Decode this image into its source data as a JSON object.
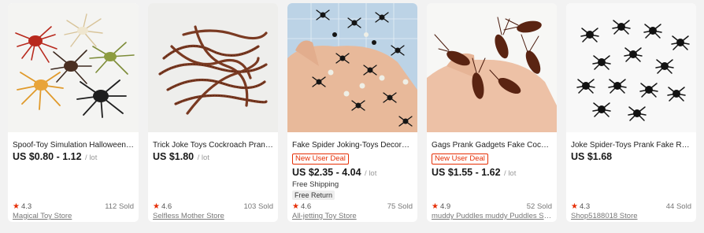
{
  "products": [
    {
      "title": "Spoof-Toy Simulation Halloween-P...",
      "price": "US $0.80 - 1.12",
      "price_unit": "/ lot",
      "badge": "",
      "shipping": "",
      "return_label": "",
      "rating": "4.3",
      "sold": "112 Sold",
      "store": "Magical Toy Store",
      "image_icon": "toy-spiders-image"
    },
    {
      "title": "Trick Joke Toys Cockroach Prank F...",
      "price": "US $1.80",
      "price_unit": "/ lot",
      "badge": "",
      "shipping": "",
      "return_label": "",
      "rating": "4.6",
      "sold": "103 Sold",
      "store": "Selfless Mother Store",
      "image_icon": "toy-centipedes-image"
    },
    {
      "title": "Fake Spider Joking-Toys Decorative...",
      "price": "US $2.35 - 4.04",
      "price_unit": "/ lot",
      "badge": "New User Deal",
      "shipping": "Free Shipping",
      "return_label": "Free Return",
      "rating": "4.6",
      "sold": "75 Sold",
      "store": "All-jetting Toy Store",
      "image_icon": "fake-spiders-hand-image"
    },
    {
      "title": "Gags Prank Gadgets Fake Cockroa...",
      "price": "US $1.55 - 1.62",
      "price_unit": "/ lot",
      "badge": "New User Deal",
      "shipping": "",
      "return_label": "",
      "rating": "4.9",
      "sold": "52 Sold",
      "store": "muddy Puddles muddy Puddles St...",
      "image_icon": "fake-cockroaches-hand-image"
    },
    {
      "title": "Joke Spider-Toys Prank Fake Realis...",
      "price": "US $1.68",
      "price_unit": "",
      "badge": "",
      "shipping": "",
      "return_label": "",
      "rating": "4.3",
      "sold": "44 Sold",
      "store": "Shop5188018 Store",
      "image_icon": "black-spiders-image"
    }
  ],
  "colors": {
    "accent": "#e62e04",
    "card_bg": "#ffffff",
    "page_bg": "#f2f2f2"
  }
}
